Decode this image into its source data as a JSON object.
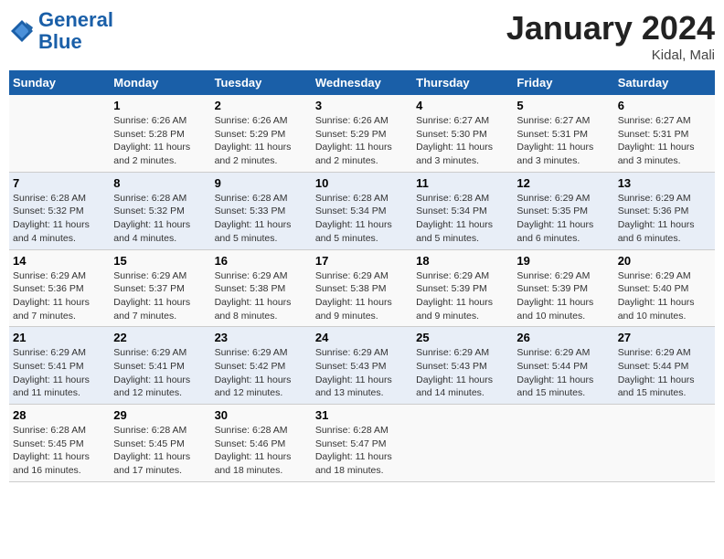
{
  "header": {
    "logo_line1": "General",
    "logo_line2": "Blue",
    "month": "January 2024",
    "location": "Kidal, Mali"
  },
  "days_of_week": [
    "Sunday",
    "Monday",
    "Tuesday",
    "Wednesday",
    "Thursday",
    "Friday",
    "Saturday"
  ],
  "weeks": [
    [
      {
        "day": "",
        "info": ""
      },
      {
        "day": "1",
        "info": "Sunrise: 6:26 AM\nSunset: 5:28 PM\nDaylight: 11 hours\nand 2 minutes."
      },
      {
        "day": "2",
        "info": "Sunrise: 6:26 AM\nSunset: 5:29 PM\nDaylight: 11 hours\nand 2 minutes."
      },
      {
        "day": "3",
        "info": "Sunrise: 6:26 AM\nSunset: 5:29 PM\nDaylight: 11 hours\nand 2 minutes."
      },
      {
        "day": "4",
        "info": "Sunrise: 6:27 AM\nSunset: 5:30 PM\nDaylight: 11 hours\nand 3 minutes."
      },
      {
        "day": "5",
        "info": "Sunrise: 6:27 AM\nSunset: 5:31 PM\nDaylight: 11 hours\nand 3 minutes."
      },
      {
        "day": "6",
        "info": "Sunrise: 6:27 AM\nSunset: 5:31 PM\nDaylight: 11 hours\nand 3 minutes."
      }
    ],
    [
      {
        "day": "7",
        "info": "Sunrise: 6:28 AM\nSunset: 5:32 PM\nDaylight: 11 hours\nand 4 minutes."
      },
      {
        "day": "8",
        "info": "Sunrise: 6:28 AM\nSunset: 5:32 PM\nDaylight: 11 hours\nand 4 minutes."
      },
      {
        "day": "9",
        "info": "Sunrise: 6:28 AM\nSunset: 5:33 PM\nDaylight: 11 hours\nand 5 minutes."
      },
      {
        "day": "10",
        "info": "Sunrise: 6:28 AM\nSunset: 5:34 PM\nDaylight: 11 hours\nand 5 minutes."
      },
      {
        "day": "11",
        "info": "Sunrise: 6:28 AM\nSunset: 5:34 PM\nDaylight: 11 hours\nand 5 minutes."
      },
      {
        "day": "12",
        "info": "Sunrise: 6:29 AM\nSunset: 5:35 PM\nDaylight: 11 hours\nand 6 minutes."
      },
      {
        "day": "13",
        "info": "Sunrise: 6:29 AM\nSunset: 5:36 PM\nDaylight: 11 hours\nand 6 minutes."
      }
    ],
    [
      {
        "day": "14",
        "info": "Sunrise: 6:29 AM\nSunset: 5:36 PM\nDaylight: 11 hours\nand 7 minutes."
      },
      {
        "day": "15",
        "info": "Sunrise: 6:29 AM\nSunset: 5:37 PM\nDaylight: 11 hours\nand 7 minutes."
      },
      {
        "day": "16",
        "info": "Sunrise: 6:29 AM\nSunset: 5:38 PM\nDaylight: 11 hours\nand 8 minutes."
      },
      {
        "day": "17",
        "info": "Sunrise: 6:29 AM\nSunset: 5:38 PM\nDaylight: 11 hours\nand 9 minutes."
      },
      {
        "day": "18",
        "info": "Sunrise: 6:29 AM\nSunset: 5:39 PM\nDaylight: 11 hours\nand 9 minutes."
      },
      {
        "day": "19",
        "info": "Sunrise: 6:29 AM\nSunset: 5:39 PM\nDaylight: 11 hours\nand 10 minutes."
      },
      {
        "day": "20",
        "info": "Sunrise: 6:29 AM\nSunset: 5:40 PM\nDaylight: 11 hours\nand 10 minutes."
      }
    ],
    [
      {
        "day": "21",
        "info": "Sunrise: 6:29 AM\nSunset: 5:41 PM\nDaylight: 11 hours\nand 11 minutes."
      },
      {
        "day": "22",
        "info": "Sunrise: 6:29 AM\nSunset: 5:41 PM\nDaylight: 11 hours\nand 12 minutes."
      },
      {
        "day": "23",
        "info": "Sunrise: 6:29 AM\nSunset: 5:42 PM\nDaylight: 11 hours\nand 12 minutes."
      },
      {
        "day": "24",
        "info": "Sunrise: 6:29 AM\nSunset: 5:43 PM\nDaylight: 11 hours\nand 13 minutes."
      },
      {
        "day": "25",
        "info": "Sunrise: 6:29 AM\nSunset: 5:43 PM\nDaylight: 11 hours\nand 14 minutes."
      },
      {
        "day": "26",
        "info": "Sunrise: 6:29 AM\nSunset: 5:44 PM\nDaylight: 11 hours\nand 15 minutes."
      },
      {
        "day": "27",
        "info": "Sunrise: 6:29 AM\nSunset: 5:44 PM\nDaylight: 11 hours\nand 15 minutes."
      }
    ],
    [
      {
        "day": "28",
        "info": "Sunrise: 6:28 AM\nSunset: 5:45 PM\nDaylight: 11 hours\nand 16 minutes."
      },
      {
        "day": "29",
        "info": "Sunrise: 6:28 AM\nSunset: 5:45 PM\nDaylight: 11 hours\nand 17 minutes."
      },
      {
        "day": "30",
        "info": "Sunrise: 6:28 AM\nSunset: 5:46 PM\nDaylight: 11 hours\nand 18 minutes."
      },
      {
        "day": "31",
        "info": "Sunrise: 6:28 AM\nSunset: 5:47 PM\nDaylight: 11 hours\nand 18 minutes."
      },
      {
        "day": "",
        "info": ""
      },
      {
        "day": "",
        "info": ""
      },
      {
        "day": "",
        "info": ""
      }
    ]
  ]
}
